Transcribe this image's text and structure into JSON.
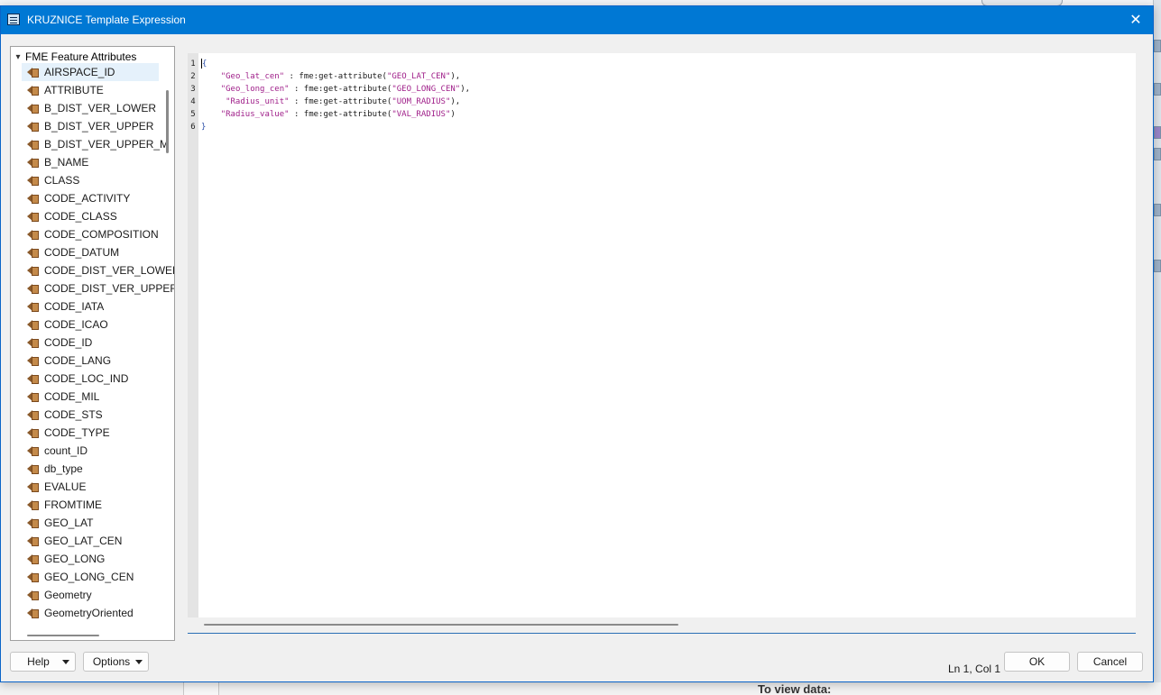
{
  "window": {
    "title": "KRUZNICE Template Expression",
    "close_glyph": "✕"
  },
  "tree": {
    "root_label": "FME Feature Attributes",
    "items": [
      "AIRSPACE_ID",
      "ATTRIBUTE",
      "B_DIST_VER_LOWER",
      "B_DIST_VER_UPPER",
      "B_DIST_VER_UPPER_M",
      "B_NAME",
      "CLASS",
      "CODE_ACTIVITY",
      "CODE_CLASS",
      "CODE_COMPOSITION",
      "CODE_DATUM",
      "CODE_DIST_VER_LOWER",
      "CODE_DIST_VER_UPPER",
      "CODE_IATA",
      "CODE_ICAO",
      "CODE_ID",
      "CODE_LANG",
      "CODE_LOC_IND",
      "CODE_MIL",
      "CODE_STS",
      "CODE_TYPE",
      "count_ID",
      "db_type",
      "EVALUE",
      "FROMTIME",
      "GEO_LAT",
      "GEO_LAT_CEN",
      "GEO_LONG",
      "GEO_LONG_CEN",
      "Geometry",
      "GeometryOriented"
    ],
    "selected_index": 0,
    "item_icon": "attribute-arrow-icon"
  },
  "editor": {
    "lines": [
      {
        "n": "1",
        "parts": [
          [
            "brace",
            "{"
          ]
        ]
      },
      {
        "n": "2",
        "parts": [
          [
            "plain",
            "    "
          ],
          [
            "str",
            "\"Geo_lat_cen\""
          ],
          [
            "plain",
            " : fme:get-attribute("
          ],
          [
            "str",
            "\"GEO_LAT_CEN\""
          ],
          [
            "plain",
            "),"
          ]
        ]
      },
      {
        "n": "3",
        "parts": [
          [
            "plain",
            "    "
          ],
          [
            "str",
            "\"Geo_long_cen\""
          ],
          [
            "plain",
            " : fme:get-attribute("
          ],
          [
            "str",
            "\"GEO_LONG_CEN\""
          ],
          [
            "plain",
            "),"
          ]
        ]
      },
      {
        "n": "4",
        "parts": [
          [
            "plain",
            "     "
          ],
          [
            "str",
            "\"Radius_unit\""
          ],
          [
            "plain",
            " : fme:get-attribute("
          ],
          [
            "str",
            "\"UOM_RADIUS\""
          ],
          [
            "plain",
            "),"
          ]
        ]
      },
      {
        "n": "5",
        "parts": [
          [
            "plain",
            "    "
          ],
          [
            "str",
            "\"Radius_value\""
          ],
          [
            "plain",
            " : fme:get-attribute("
          ],
          [
            "str",
            "\"VAL_RADIUS\""
          ],
          [
            "plain",
            ")"
          ]
        ]
      },
      {
        "n": "6",
        "parts": [
          [
            "brace",
            "}"
          ]
        ]
      }
    ]
  },
  "footer": {
    "help_label": "Help",
    "options_label": "Options",
    "status": "Ln 1, Col 1",
    "ok_label": "OK",
    "cancel_label": "Cancel"
  },
  "background": {
    "hint_text": "To view data:"
  }
}
